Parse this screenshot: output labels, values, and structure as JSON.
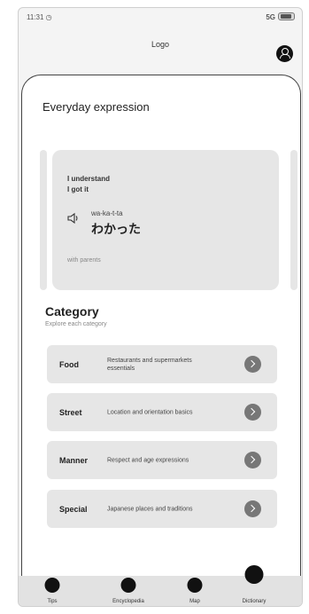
{
  "status_bar": {
    "time": "11:31 ◷",
    "signal": "5G"
  },
  "header": {
    "logo": "Logo"
  },
  "expression": {
    "section_title": "Everyday expression",
    "card": {
      "english_line1": "I understand",
      "english_line2": "I got it",
      "romaji": "wa-ka-t-ta",
      "japanese": "わかった",
      "hint": "with parents"
    }
  },
  "category": {
    "title": "Category",
    "subtitle": "Explore each category",
    "items": [
      {
        "name": "Food",
        "desc": "Restaurants and supermarkets essentials"
      },
      {
        "name": "Street",
        "desc": "Location and orientation basics"
      },
      {
        "name": "Manner",
        "desc": "Respect and age expressions"
      },
      {
        "name": "Special",
        "desc": "Japanese places and traditions"
      }
    ]
  },
  "tabs": [
    {
      "label": "Tips"
    },
    {
      "label": "Encyclopedia"
    },
    {
      "label": "Map"
    },
    {
      "label": "Dictionary"
    }
  ],
  "colors": {
    "card": "#e6e6e6",
    "tabbar": "#e2e2e2",
    "icon": "#111111",
    "arrow": "#777777"
  }
}
